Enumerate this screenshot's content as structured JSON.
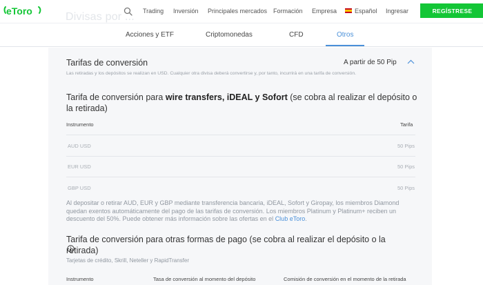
{
  "brand": {
    "name": "eToro",
    "accent": "#13c636",
    "link_color": "#4a90d9"
  },
  "header": {
    "ghost_title": "Divisas por ...",
    "nav": [
      "Trading",
      "Inversión",
      "Principales mercados",
      "Formación",
      "Empresa"
    ],
    "language": "Español",
    "login": "Ingresar",
    "register": "REGÍSTRESE"
  },
  "tabs": [
    {
      "label": "Acciones y ETF",
      "active": false
    },
    {
      "label": "Criptomonedas",
      "active": false
    },
    {
      "label": "CFD",
      "active": false
    },
    {
      "label": "Otros",
      "active": true
    }
  ],
  "conversion": {
    "title": "Tarifas de conversión",
    "value": "A partir de 50 Pip",
    "note": "Las retiradas y los depósitos se realizan en USD. Cualquier otra divisa deberá convertirse y, por tanto, incurrirá en una tarifa de conversión."
  },
  "section1": {
    "title_pre": "Tarifa de conversión para ",
    "title_bold": "wire transfers, iDEAL y Sofort",
    "title_post": " (se cobra al realizar el depósito o la retirada)",
    "col_instrument": "Instrumento",
    "col_fee": "Tarifa",
    "rows": [
      {
        "instrument": "AUD USD",
        "fee": "50 Pips"
      },
      {
        "instrument": "EUR USD",
        "fee": "50 Pips"
      },
      {
        "instrument": "GBP USD",
        "fee": "50 Pips"
      }
    ],
    "paragraph": "Al depositar o retirar AUD, EUR y GBP mediante transferencia bancaria, iDEAL, Sofort y Giropay, los miembros Diamond quedan exentos automáticamente del pago de las tarifas de conversión. Los miembros Platinum y Platinum+ reciben un descuento del 50%. Puede obtener más información sobre las ofertas en el ",
    "link": "Club eToro",
    "paragraph_end": "."
  },
  "section2": {
    "title": "Tarifa de conversión para otras formas de pago (se cobra al realizar el depósito o la retirada)",
    "note": "Tarjetas de crédito, Skrill, Neteller y RapidTransfer",
    "col_instrument": "Instrumento",
    "col_rate": "Tasa de conversión al momento del depósito",
    "col_commission": "Comisión de conversión en el momento de la retirada"
  }
}
